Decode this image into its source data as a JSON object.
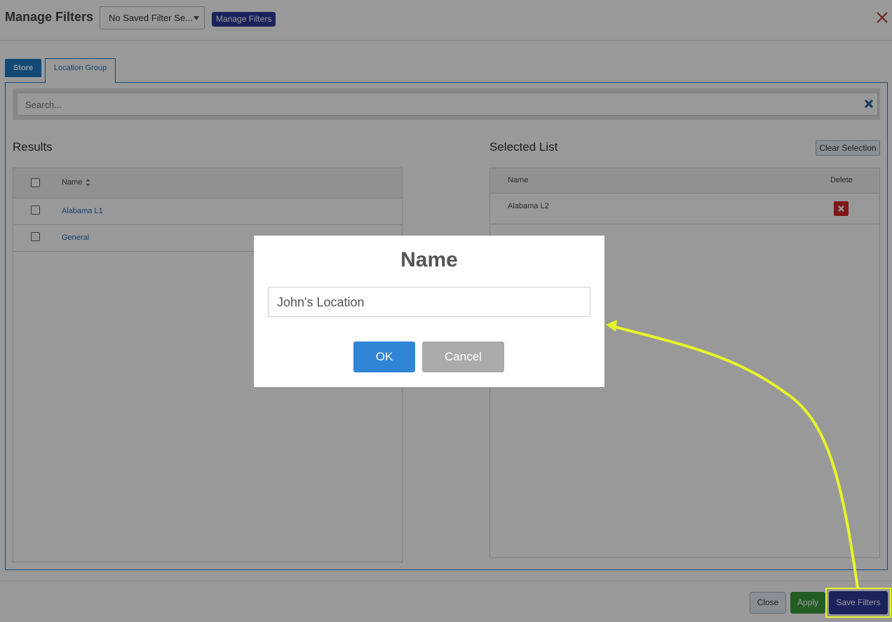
{
  "header": {
    "title": "Manage Filters",
    "saved_filter_select": "No Saved Filter Se...",
    "manage_filters_button": "Manage Filters"
  },
  "tabs": [
    {
      "label": "Store",
      "active": false
    },
    {
      "label": "Location Group",
      "active": true
    }
  ],
  "search": {
    "placeholder": "Search..."
  },
  "results": {
    "title": "Results",
    "column_name": "Name",
    "rows": [
      {
        "label": "Alabama L1"
      },
      {
        "label": "General"
      }
    ]
  },
  "selected": {
    "title": "Selected List",
    "clear_button": "Clear Selection",
    "column_name": "Name",
    "column_delete": "Delete",
    "rows": [
      {
        "label": "Alabama L2"
      }
    ]
  },
  "footer": {
    "close_button": "Close",
    "apply_button": "Apply",
    "save_button": "Save Filters"
  },
  "dialog": {
    "title": "Name",
    "input_value": "John's Location",
    "ok_button": "OK",
    "cancel_button": "Cancel"
  },
  "colors": {
    "primary": "#2e3a9a",
    "tab_blue": "#1f7ac6",
    "apply_green": "#3b9c3b",
    "delete_red": "#d42a2a",
    "ok_blue": "#3085d6",
    "highlight_yellow": "#e6f52a"
  },
  "icons": [
    "close-icon",
    "search-clear-icon",
    "sort-icon",
    "delete-icon",
    "caret-down-icon"
  ]
}
